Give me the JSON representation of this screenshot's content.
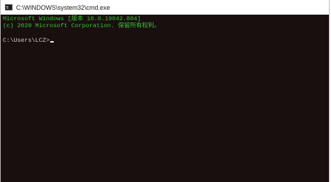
{
  "window": {
    "title": "C:\\WINDOWS\\system32\\cmd.exe",
    "icon": "console-app-icon"
  },
  "console": {
    "lines": [
      "Microsoft Windows [版本 10.0.19042.804]",
      "(c) 2020 Microsoft Corporation. 保留所有权利。"
    ],
    "prompt": "C:\\Users\\LCZ>"
  },
  "colors": {
    "console_background": "#1a0f0f",
    "text_green": "#35c435",
    "prompt_text": "#cccccc"
  }
}
